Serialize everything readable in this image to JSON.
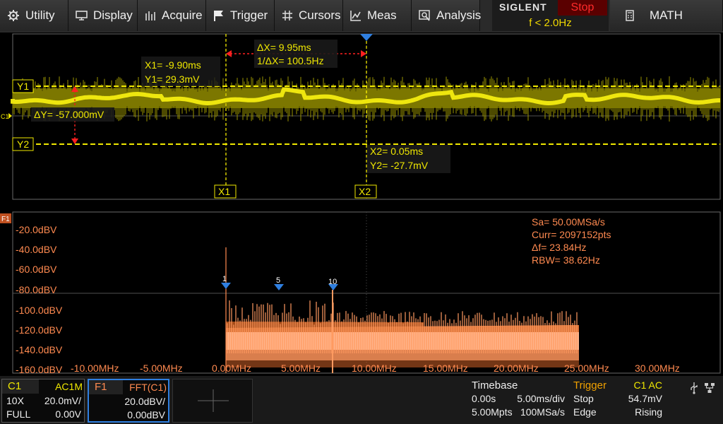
{
  "menu": {
    "utility": "Utility",
    "display": "Display",
    "acquire": "Acquire",
    "trigger": "Trigger",
    "cursors": "Cursors",
    "meas": "Meas",
    "analysis": "Analysis",
    "math": "MATH"
  },
  "brand": {
    "name": "SIGLENT",
    "run_status": "Stop",
    "frequency": "f < 2.0Hz"
  },
  "time_domain": {
    "channel_marker": "C1",
    "cursor_y1_label": "Y1",
    "cursor_y2_label": "Y2",
    "cursor_x1_label": "X1",
    "cursor_x2_label": "X2",
    "x1_readout": "X1= -9.90ms",
    "y1_readout": "Y1= 29.3mV",
    "x2_readout": "X2= 0.05ms",
    "y2_readout": "Y2= -27.7mV",
    "delta_x": "ΔX= 9.95ms",
    "inverse_delta_x": "1/ΔX= 100.5Hz",
    "delta_y": "ΔY= -57.000mV",
    "trace_color": "#f0e800",
    "cursor_color": "#f0e800",
    "delta_marker_color": "#ff2020"
  },
  "fft": {
    "marker": "F1",
    "params": [
      "Sa= 50.00MSa/s",
      "Curr= 2097152pts",
      "Δf= 23.84Hz",
      "RBW= 38.62Hz"
    ],
    "y_ticks": [
      "-20.0dBV",
      "-40.0dBV",
      "-60.0dBV",
      "-80.0dBV",
      "-100.0dBV",
      "-120.0dBV",
      "-140.0dBV",
      "-160.0dBV"
    ],
    "x_ticks": [
      "-10.00MHz",
      "-5.00MHz",
      "0.00MHz",
      "5.00MHz",
      "10.00MHz",
      "15.00MHz",
      "20.00MHz",
      "25.00MHz",
      "30.00MHz"
    ],
    "peak_markers": [
      "1",
      "5",
      "10"
    ],
    "trace_color": "#ff8a50",
    "text_color": "#ff8a50"
  },
  "status": {
    "c1": {
      "title": "C1",
      "coupling": "AC1M",
      "probe": "10X",
      "scale": "20.0mV/",
      "bandwidth": "FULL",
      "offset": "0.00V"
    },
    "f1": {
      "title": "F1",
      "source": "FFT(C1)",
      "scale": "20.0dBV/",
      "offset": "0.00dBV"
    },
    "timebase": {
      "title": "Timebase",
      "delay": "0.00s",
      "scale": "5.00ms/div",
      "memory": "5.00Mpts",
      "rate": "100MSa/s"
    },
    "trigger": {
      "title": "Trigger",
      "source": "C1 AC",
      "state": "Stop",
      "level": "54.7mV",
      "type": "Edge",
      "slope": "Rising"
    }
  }
}
